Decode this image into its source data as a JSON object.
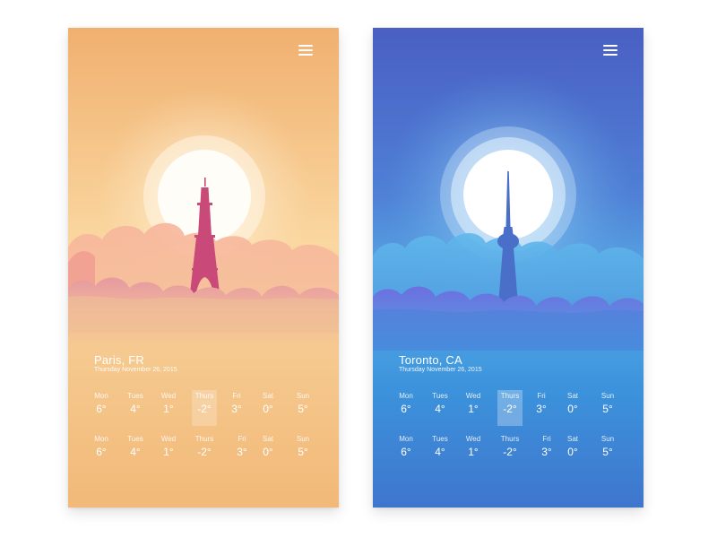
{
  "cards": [
    {
      "city": "Paris, FR",
      "date": "Thursday November 26, 2015",
      "forecast_rows": [
        [
          {
            "day": "Mon",
            "temp": "6°"
          },
          {
            "day": "Tues",
            "temp": "4°"
          },
          {
            "day": "Wed",
            "temp": "1°"
          },
          {
            "day": "Thurs",
            "temp": "-2°"
          },
          {
            "day": "Fri",
            "temp": "3°"
          },
          {
            "day": "Sat",
            "temp": "0°"
          },
          {
            "day": "Sun",
            "temp": "5°"
          }
        ],
        [
          {
            "day": "Mon",
            "temp": "6°"
          },
          {
            "day": "Tues",
            "temp": "4°"
          },
          {
            "day": "Wed",
            "temp": "1°"
          },
          {
            "day": "Thurs",
            "temp": "-2°"
          },
          {
            "day": "Fri",
            "temp": "3°"
          },
          {
            "day": "Sat",
            "temp": "0°"
          },
          {
            "day": "Sun",
            "temp": "5°"
          }
        ]
      ],
      "selected_day": "Thurs",
      "colors": {
        "sky_top": "#f2b36f",
        "sky_bottom": "#f4c67f",
        "landmark": "#c94a78"
      },
      "landmark_icon": "eiffel-tower-icon"
    },
    {
      "city": "Toronto, CA",
      "date": "Thursday November 26, 2015",
      "forecast_rows": [
        [
          {
            "day": "Mon",
            "temp": "6°"
          },
          {
            "day": "Tues",
            "temp": "4°"
          },
          {
            "day": "Wed",
            "temp": "1°"
          },
          {
            "day": "Thurs",
            "temp": "-2°"
          },
          {
            "day": "Fri",
            "temp": "3°"
          },
          {
            "day": "Sat",
            "temp": "0°"
          },
          {
            "day": "Sun",
            "temp": "5°"
          }
        ],
        [
          {
            "day": "Mon",
            "temp": "6°"
          },
          {
            "day": "Tues",
            "temp": "4°"
          },
          {
            "day": "Wed",
            "temp": "1°"
          },
          {
            "day": "Thurs",
            "temp": "-2°"
          },
          {
            "day": "Fri",
            "temp": "3°"
          },
          {
            "day": "Sat",
            "temp": "0°"
          },
          {
            "day": "Sun",
            "temp": "5°"
          }
        ]
      ],
      "selected_day": "Thurs",
      "colors": {
        "sky_top": "#4a62c4",
        "sky_bottom": "#3c80d8",
        "landmark": "#4a6fc9"
      },
      "landmark_icon": "cn-tower-icon"
    }
  ],
  "menu_icon": "hamburger-menu-icon"
}
